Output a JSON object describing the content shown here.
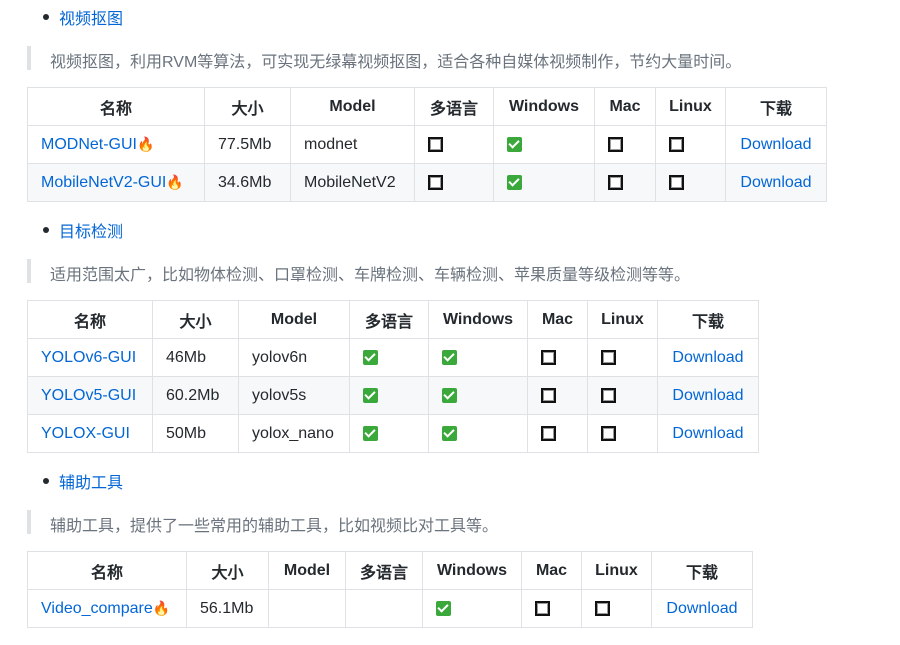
{
  "sections": [
    {
      "title": "视频抠图",
      "description": "视频抠图，利用RVM等算法，可实现无绿幕视频抠图，适合各种自媒体视频制作，节约大量时间。",
      "headers": [
        "名称",
        "大小",
        "Model",
        "多语言",
        "Windows",
        "Mac",
        "Linux",
        "下载"
      ],
      "rows": [
        {
          "name": "MODNet-GUI",
          "fire": "🔥",
          "size": "77.5Mb",
          "model": "modnet",
          "multilang": false,
          "windows": true,
          "mac": false,
          "linux": false,
          "download": "Download"
        },
        {
          "name": "MobileNetV2-GUI",
          "fire": "🔥",
          "size": "34.6Mb",
          "model": "MobileNetV2",
          "multilang": false,
          "windows": true,
          "mac": false,
          "linux": false,
          "download": "Download"
        }
      ]
    },
    {
      "title": "目标检测",
      "description": "适用范围太广，比如物体检测、口罩检测、车牌检测、车辆检测、苹果质量等级检测等等。",
      "headers": [
        "名称",
        "大小",
        "Model",
        "多语言",
        "Windows",
        "Mac",
        "Linux",
        "下载"
      ],
      "rows": [
        {
          "name": "YOLOv6-GUI",
          "fire": "",
          "size": "46Mb",
          "model": "yolov6n",
          "multilang": true,
          "windows": true,
          "mac": false,
          "linux": false,
          "download": "Download"
        },
        {
          "name": "YOLOv5-GUI",
          "fire": "",
          "size": "60.2Mb",
          "model": "yolov5s",
          "multilang": true,
          "windows": true,
          "mac": false,
          "linux": false,
          "download": "Download"
        },
        {
          "name": "YOLOX-GUI",
          "fire": "",
          "size": "50Mb",
          "model": "yolox_nano",
          "multilang": true,
          "windows": true,
          "mac": false,
          "linux": false,
          "download": "Download"
        }
      ]
    },
    {
      "title": "辅助工具",
      "description": "辅助工具，提供了一些常用的辅助工具，比如视频比对工具等。",
      "headers": [
        "名称",
        "大小",
        "Model",
        "多语言",
        "Windows",
        "Mac",
        "Linux",
        "下载"
      ],
      "rows": [
        {
          "name": "Video_compare",
          "fire": "🔥",
          "size": "56.1Mb",
          "model": "",
          "multilang": null,
          "windows": true,
          "mac": false,
          "linux": false,
          "download": "Download"
        }
      ]
    }
  ],
  "colors": {
    "link": "#0366d6",
    "text": "#24292e",
    "quote": "#6a737d",
    "border": "#dfe2e5",
    "check": "#3aa83a"
  }
}
